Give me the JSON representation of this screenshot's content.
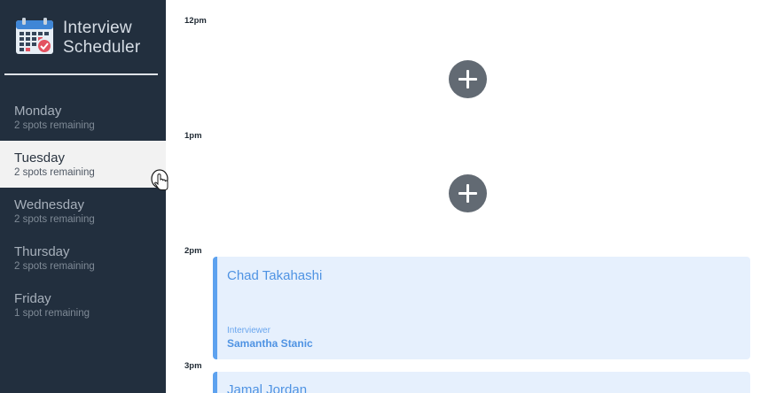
{
  "app": {
    "title": "Interview\nScheduler"
  },
  "days": [
    {
      "name": "Monday",
      "spots": "2 spots remaining"
    },
    {
      "name": "Tuesday",
      "spots": "2 spots remaining"
    },
    {
      "name": "Wednesday",
      "spots": "2 spots remaining"
    },
    {
      "name": "Thursday",
      "spots": "2 spots remaining"
    },
    {
      "name": "Friday",
      "spots": "1 spot remaining"
    }
  ],
  "selected_day": "Tuesday",
  "schedule": {
    "times": [
      "12pm",
      "1pm",
      "2pm",
      "3pm"
    ],
    "appointments": [
      {
        "student": "Chad Takahashi",
        "interviewer_label": "Interviewer",
        "interviewer": "Samantha Stanic"
      },
      {
        "student": "Jamal Jordan"
      }
    ]
  },
  "colors": {
    "sidebar": "#222f3e",
    "selected_day_bg": "#f2f2f2",
    "add_button": "#626a73",
    "appointment_bg": "#e6f0fd",
    "appointment_accent": "#5da2ef",
    "appointment_text": "#4f93e3"
  },
  "icons": {
    "logo": "calendar-logo-icon",
    "add": "plus-icon",
    "cursor": "hand-pointer-icon"
  }
}
